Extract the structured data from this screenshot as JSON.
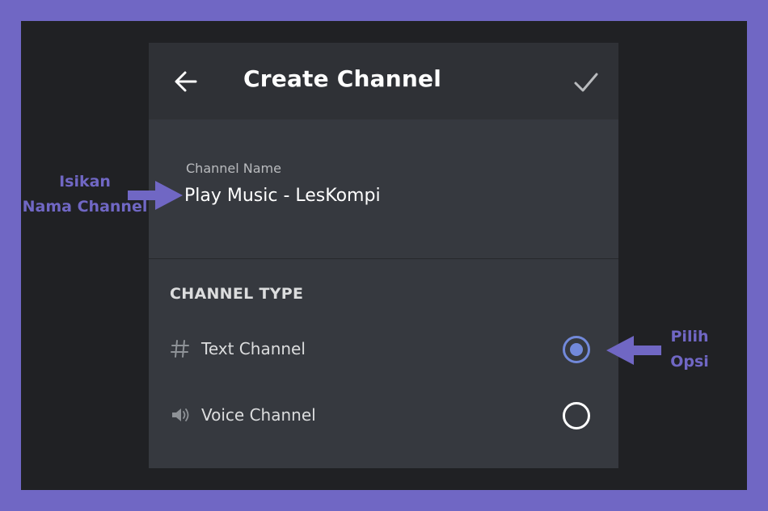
{
  "header": {
    "title": "Create Channel",
    "back_icon": "arrow-left-icon",
    "confirm_icon": "check-icon"
  },
  "channel_name": {
    "label": "Channel Name",
    "value": "Play Music - LesKompi"
  },
  "channel_type": {
    "heading": "CHANNEL TYPE",
    "options": [
      {
        "label": "Text Channel",
        "icon": "hash-icon",
        "selected": true
      },
      {
        "label": "Voice Channel",
        "icon": "speaker-icon",
        "selected": false
      }
    ]
  },
  "annotations": {
    "left_line1": "Isikan",
    "left_line2": "Nama Channel",
    "right_line1": "Pilih",
    "right_line2": "Opsi"
  },
  "colors": {
    "outer_border": "#7067c4",
    "background": "#202124",
    "panel": "#36393f",
    "header": "#2f3136",
    "accent": "#7289da"
  }
}
